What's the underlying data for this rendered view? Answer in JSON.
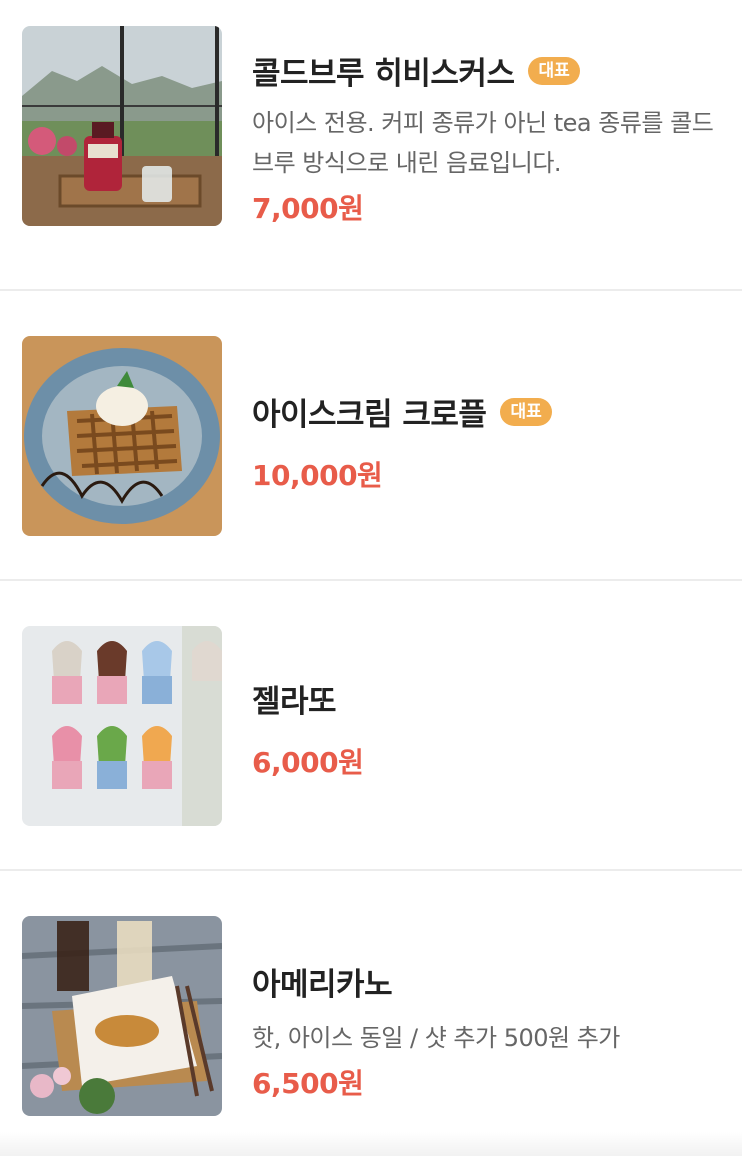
{
  "menu_items": [
    {
      "title": "콜드브루 히비스커스",
      "badge": "대표",
      "description": "아이스 전용. 커피 종류가 아닌 tea 종류를 콜드브루 방식으로 내린 음료입니다.",
      "price": "7,000원"
    },
    {
      "title": "아이스크림 크로플",
      "badge": "대표",
      "price": "10,000원"
    },
    {
      "title": "젤라또",
      "price": "6,000원"
    },
    {
      "title": "아메리카노",
      "description": "핫, 아이스 동일 / 샷 추가 500원 추가",
      "price": "6,500원"
    }
  ],
  "colors": {
    "badge": "#f2ad4e",
    "price": "#e85c4a",
    "title": "#222222",
    "description": "#666666"
  }
}
